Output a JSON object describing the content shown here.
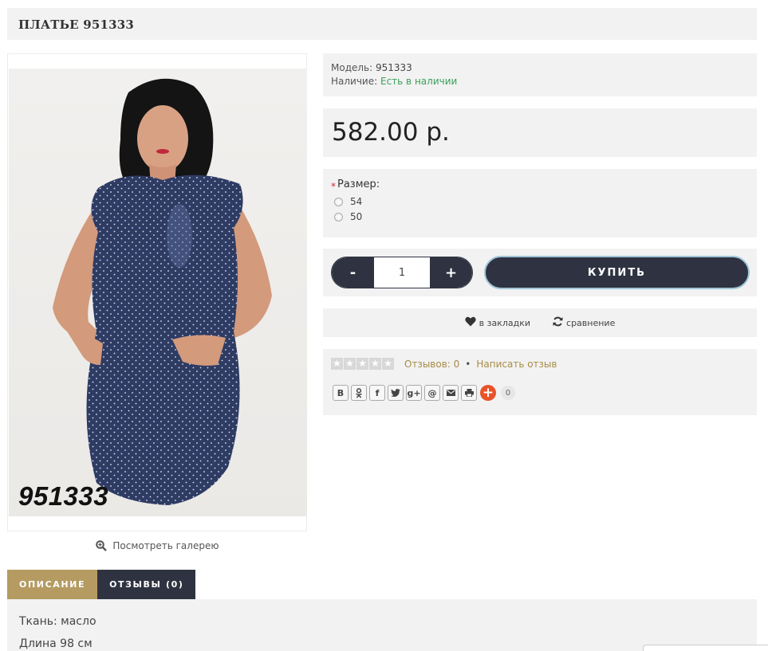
{
  "product": {
    "title": "ПЛАТЬЕ 951333",
    "sku_overlay": "951333",
    "model_label": "Модель:",
    "model_value": "951333",
    "availability_label": "Наличие:",
    "availability_value": "Есть в наличии",
    "price": "582.00 р.",
    "gallery_link": "Посмотреть галерею"
  },
  "options": {
    "required_mark": "*",
    "size_label": "Размер:",
    "sizes": [
      "54",
      "50"
    ]
  },
  "cart": {
    "minus": "-",
    "quantity": "1",
    "plus": "+",
    "buy_label": "КУПИТЬ"
  },
  "actions": {
    "wishlist": "в закладки",
    "compare": "сравнение"
  },
  "reviews": {
    "rating": 0,
    "max": 5,
    "count_text": "Отзывов: 0",
    "separator": "•",
    "write_text": "Написать отзыв"
  },
  "share": {
    "buttons": [
      "В",
      "ok",
      "f",
      "tw",
      "g+",
      "@",
      "mail",
      "print"
    ],
    "vk": "В",
    "ok": "ok",
    "fb": "f",
    "gplus": "g+",
    "at": "@",
    "count": "0"
  },
  "tabs": {
    "description": "ОПИСАНИЕ",
    "reviews": "ОТЗЫВЫ (0)"
  },
  "description": {
    "line1": "Ткань: масло",
    "line2": "Длина 98 см"
  },
  "colors": {
    "dark": "#2f3341",
    "gold": "#b59b62",
    "green": "#3aa05a",
    "panel": "#f2f2f2"
  }
}
